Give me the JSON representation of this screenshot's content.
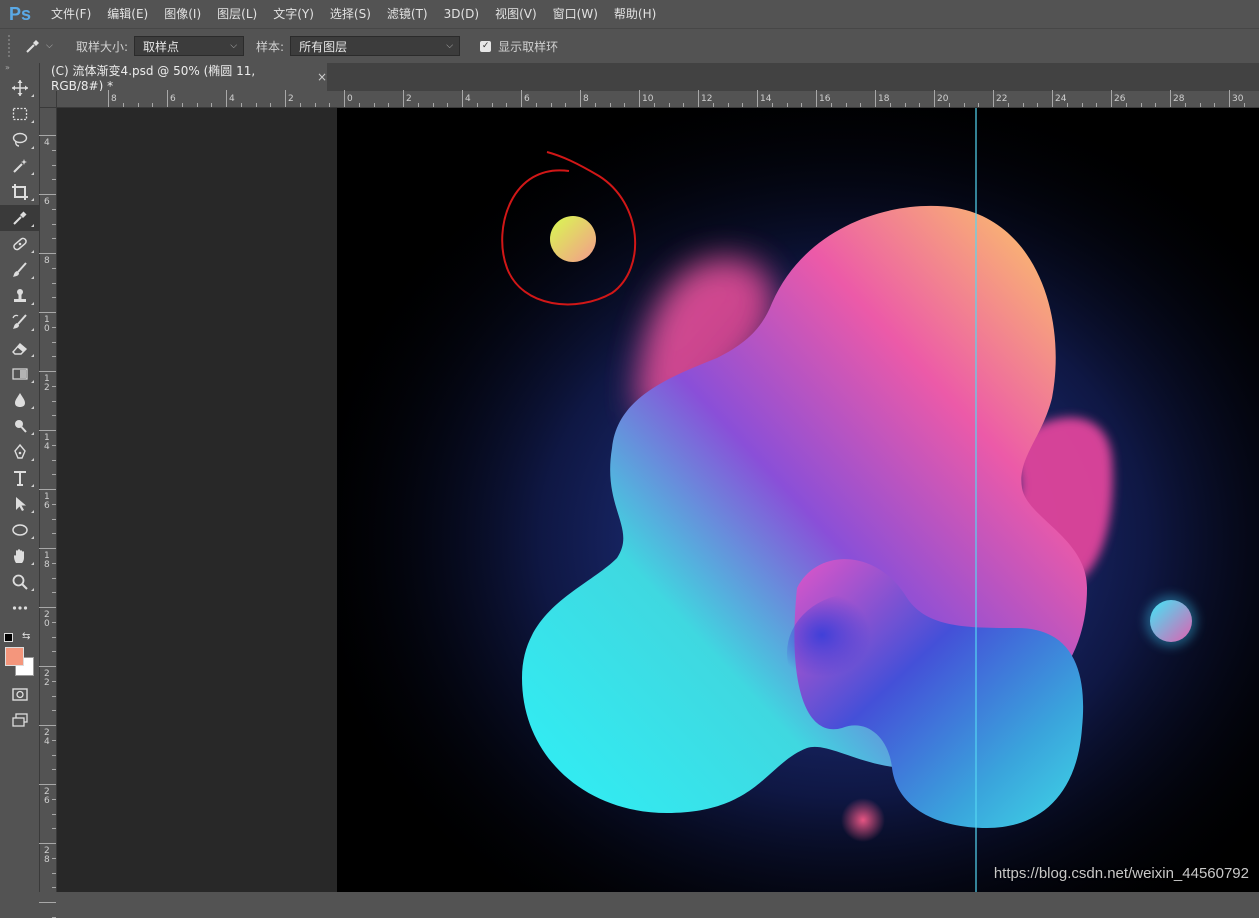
{
  "app": {
    "logo": "Ps",
    "menu": [
      "文件(F)",
      "编辑(E)",
      "图像(I)",
      "图层(L)",
      "文字(Y)",
      "选择(S)",
      "滤镜(T)",
      "3D(D)",
      "视图(V)",
      "窗口(W)",
      "帮助(H)"
    ]
  },
  "options": {
    "sample_size_label": "取样大小:",
    "sample_size_value": "取样点",
    "sample_label": "样本:",
    "sample_value": "所有图层",
    "show_ring_label": "显示取样环",
    "show_ring_checked": true
  },
  "document": {
    "tab_title": "(C) 流体渐变4.psd @ 50% (椭圆 11, RGB/8#) *",
    "close_glyph": "×"
  },
  "rulers": {
    "horizontal": [
      "8",
      "6",
      "4",
      "2",
      "0",
      "2",
      "4",
      "6",
      "8",
      "10",
      "12",
      "14",
      "16",
      "18",
      "20",
      "22",
      "24",
      "26",
      "28",
      "30"
    ],
    "vertical": [
      "4",
      "6",
      "8",
      "10",
      "12",
      "14",
      "16",
      "18",
      "20",
      "22",
      "24",
      "26",
      "28"
    ]
  },
  "tools": [
    {
      "name": "move-tool",
      "icon": "move-icon"
    },
    {
      "name": "marquee-tool",
      "icon": "rect-marquee-icon"
    },
    {
      "name": "lasso-tool",
      "icon": "lasso-icon"
    },
    {
      "name": "magic-wand-tool",
      "icon": "magic-wand-icon"
    },
    {
      "name": "crop-tool",
      "icon": "crop-icon"
    },
    {
      "name": "eyedropper-tool",
      "icon": "eyedropper-icon",
      "active": true
    },
    {
      "name": "healing-brush-tool",
      "icon": "bandage-icon"
    },
    {
      "name": "brush-tool",
      "icon": "brush-icon"
    },
    {
      "name": "clone-stamp-tool",
      "icon": "stamp-icon"
    },
    {
      "name": "history-brush-tool",
      "icon": "history-brush-icon"
    },
    {
      "name": "eraser-tool",
      "icon": "eraser-icon"
    },
    {
      "name": "gradient-tool",
      "icon": "gradient-icon"
    },
    {
      "name": "blur-tool",
      "icon": "drop-icon"
    },
    {
      "name": "dodge-tool",
      "icon": "dodge-icon"
    },
    {
      "name": "pen-tool",
      "icon": "pen-icon"
    },
    {
      "name": "type-tool",
      "icon": "type-icon"
    },
    {
      "name": "path-select-tool",
      "icon": "arrow-icon"
    },
    {
      "name": "ellipse-tool",
      "icon": "ellipse-icon"
    },
    {
      "name": "hand-tool",
      "icon": "hand-icon"
    },
    {
      "name": "zoom-tool",
      "icon": "zoom-icon"
    },
    {
      "name": "more-tools",
      "icon": "more-icon"
    }
  ],
  "colors": {
    "foreground": "#f4967c",
    "background": "#ffffff",
    "guide": "#55d6f2",
    "annotation": "#d11717"
  },
  "watermark": "https://blog.csdn.net/weixin_44560792"
}
